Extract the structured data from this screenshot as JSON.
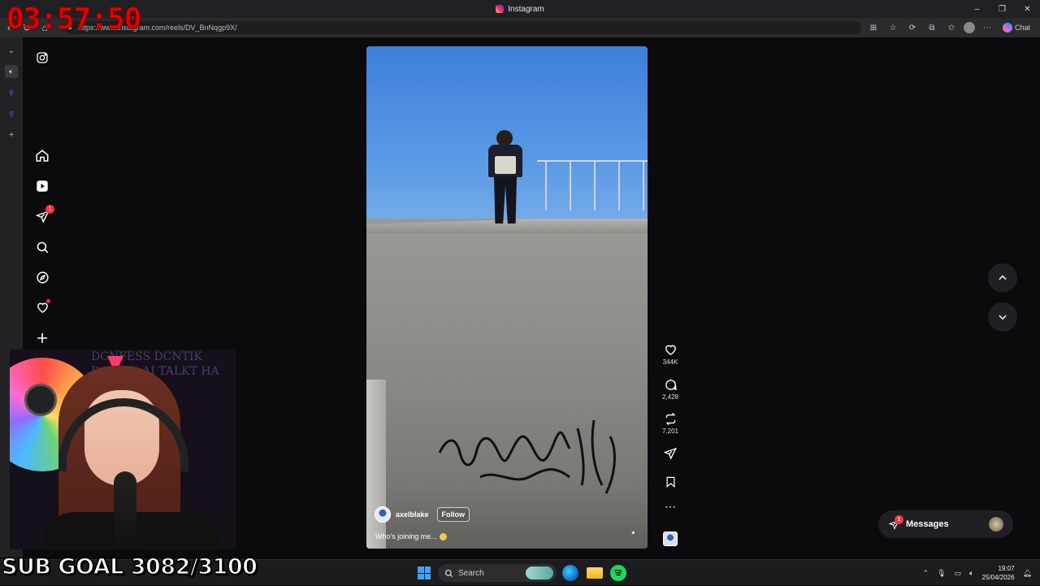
{
  "browser": {
    "tab_title": "Instagram",
    "url": "https://www.instagram.com/reels/DV_BnNqgp9X/",
    "chat_label": "Chat",
    "window_controls": [
      "–",
      "❐",
      "✕"
    ]
  },
  "overlay": {
    "timer": "03:57:50",
    "sub_goal": "SUB GOAL 3082/3100"
  },
  "ig_nav": {
    "messages_badge": "1"
  },
  "reel": {
    "username": "axelblake",
    "follow_label": "Follow",
    "caption": "Who's joining me...",
    "likes": "344K",
    "comments": "2,428",
    "reposts": "7,201"
  },
  "messages": {
    "label": "Messages",
    "badge": "1"
  },
  "webcam": {
    "wall_text": "DCNFESS DCNTIK DANIEL AI TALKT HA"
  },
  "taskbar": {
    "search_placeholder": "Search",
    "time": "19:07",
    "date": "25/04/2026"
  },
  "colors": {
    "accent_red": "#ff3040",
    "timer_red": "#e50000"
  }
}
